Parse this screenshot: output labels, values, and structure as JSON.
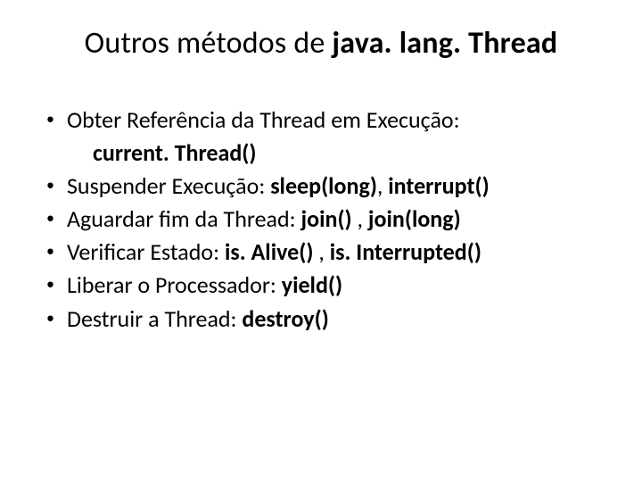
{
  "title_plain": "Outros métodos de ",
  "title_bold": "java. lang. Thread",
  "items": [
    {
      "prefix": "Obter Referência da Thread em Execução:",
      "sub_bold": "current. Thread()"
    },
    {
      "prefix": "Suspender Execução: ",
      "bold": "sleep(long)",
      "mid": ", ",
      "bold2": "interrupt()"
    },
    {
      "prefix": "Aguardar  fim da Thread: ",
      "bold": "join()",
      "mid": " ,  ",
      "bold2": "join(long)"
    },
    {
      "prefix": "Verificar Estado:  ",
      "bold": "is. Alive()",
      "mid": " , ",
      "bold2": "is. Interrupted()"
    },
    {
      "prefix": "Liberar o Processador:  ",
      "bold": "yield()"
    },
    {
      "prefix": "Destruir a Thread:  ",
      "bold": "destroy()"
    }
  ]
}
